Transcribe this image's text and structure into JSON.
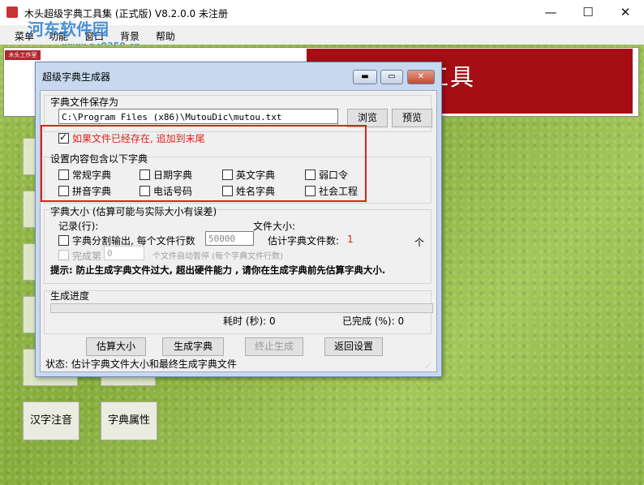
{
  "window": {
    "title": "木头超级字典工具集 (正式版) V8.2.0.0     未注册",
    "min_label": "—",
    "max_label": "☐",
    "close_label": "✕"
  },
  "watermark": {
    "text": "河东软件园",
    "url": "www.pc0359.cn"
  },
  "menu": [
    "菜单",
    "功能",
    "窗口",
    "背景",
    "帮助"
  ],
  "banner": {
    "logo_text": "木头工作室",
    "text": "提交监控工具"
  },
  "desktop_buttons": {
    "hanzi": "汉字注音",
    "dict_attr": "字典属性"
  },
  "dialog": {
    "title": "超级字典生成器",
    "save_group": "字典文件保存为",
    "path_value": "C:\\Program Files (x86)\\MutouDic\\mutou.txt",
    "browse": "浏览",
    "preview": "预览",
    "append_label": "如果文件已经存在, 追加到末尾",
    "content_group": "设置内容包含以下字典",
    "options": [
      "常规字典",
      "日期字典",
      "英文字典",
      "弱口令",
      "拼音字典",
      "电话号码",
      "姓名字典",
      "社会工程"
    ],
    "size_group": "字典大小 (估算可能与实际大小有误差)",
    "records_label": "记录(行):",
    "filesize_label": "文件大小:",
    "split_label": "字典分割输出, 每个文件行数",
    "split_value": "50000",
    "est_count_label": "估计字典文件数:",
    "est_count_value": "1",
    "unit": "个",
    "done_label": "完成第",
    "done_value": "0",
    "done_tail": "个文件自动暂停 (每个字典文件行数)",
    "tip": "提示: 防止生成字典文件过大, 超出硬件能力 , 请你在生成字典前先估算字典大小.",
    "progress_group": "生成进度",
    "progress": 0,
    "elapsed_label": "耗时 (秒): 0",
    "completed_label": "已完成 (%): 0",
    "btn_estimate": "估算大小",
    "btn_generate": "生成字典",
    "btn_stop": "终止生成",
    "btn_back": "返回设置",
    "status": "状态:  估计字典文件大小和最终生成字典文件"
  },
  "colors": {
    "highlight": "#e0201a",
    "banner": "#a60d14",
    "accent_text": "#e0201a"
  }
}
